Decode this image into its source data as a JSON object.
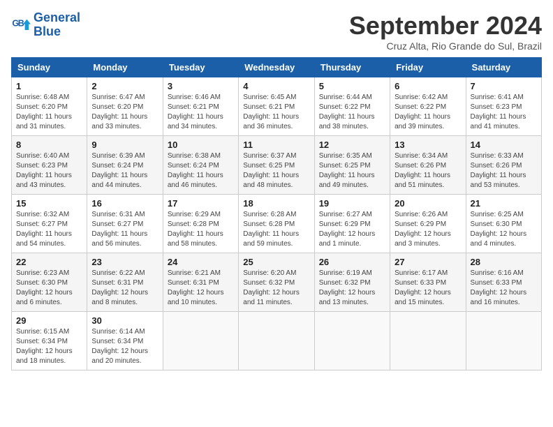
{
  "logo": {
    "line1": "General",
    "line2": "Blue"
  },
  "title": "September 2024",
  "location": "Cruz Alta, Rio Grande do Sul, Brazil",
  "weekdays": [
    "Sunday",
    "Monday",
    "Tuesday",
    "Wednesday",
    "Thursday",
    "Friday",
    "Saturday"
  ],
  "weeks": [
    [
      {
        "day": "1",
        "sunrise": "6:48 AM",
        "sunset": "6:20 PM",
        "daylight": "11 hours and 31 minutes."
      },
      {
        "day": "2",
        "sunrise": "6:47 AM",
        "sunset": "6:20 PM",
        "daylight": "11 hours and 33 minutes."
      },
      {
        "day": "3",
        "sunrise": "6:46 AM",
        "sunset": "6:21 PM",
        "daylight": "11 hours and 34 minutes."
      },
      {
        "day": "4",
        "sunrise": "6:45 AM",
        "sunset": "6:21 PM",
        "daylight": "11 hours and 36 minutes."
      },
      {
        "day": "5",
        "sunrise": "6:44 AM",
        "sunset": "6:22 PM",
        "daylight": "11 hours and 38 minutes."
      },
      {
        "day": "6",
        "sunrise": "6:42 AM",
        "sunset": "6:22 PM",
        "daylight": "11 hours and 39 minutes."
      },
      {
        "day": "7",
        "sunrise": "6:41 AM",
        "sunset": "6:23 PM",
        "daylight": "11 hours and 41 minutes."
      }
    ],
    [
      {
        "day": "8",
        "sunrise": "6:40 AM",
        "sunset": "6:23 PM",
        "daylight": "11 hours and 43 minutes."
      },
      {
        "day": "9",
        "sunrise": "6:39 AM",
        "sunset": "6:24 PM",
        "daylight": "11 hours and 44 minutes."
      },
      {
        "day": "10",
        "sunrise": "6:38 AM",
        "sunset": "6:24 PM",
        "daylight": "11 hours and 46 minutes."
      },
      {
        "day": "11",
        "sunrise": "6:37 AM",
        "sunset": "6:25 PM",
        "daylight": "11 hours and 48 minutes."
      },
      {
        "day": "12",
        "sunrise": "6:35 AM",
        "sunset": "6:25 PM",
        "daylight": "11 hours and 49 minutes."
      },
      {
        "day": "13",
        "sunrise": "6:34 AM",
        "sunset": "6:26 PM",
        "daylight": "11 hours and 51 minutes."
      },
      {
        "day": "14",
        "sunrise": "6:33 AM",
        "sunset": "6:26 PM",
        "daylight": "11 hours and 53 minutes."
      }
    ],
    [
      {
        "day": "15",
        "sunrise": "6:32 AM",
        "sunset": "6:27 PM",
        "daylight": "11 hours and 54 minutes."
      },
      {
        "day": "16",
        "sunrise": "6:31 AM",
        "sunset": "6:27 PM",
        "daylight": "11 hours and 56 minutes."
      },
      {
        "day": "17",
        "sunrise": "6:29 AM",
        "sunset": "6:28 PM",
        "daylight": "11 hours and 58 minutes."
      },
      {
        "day": "18",
        "sunrise": "6:28 AM",
        "sunset": "6:28 PM",
        "daylight": "11 hours and 59 minutes."
      },
      {
        "day": "19",
        "sunrise": "6:27 AM",
        "sunset": "6:29 PM",
        "daylight": "12 hours and 1 minute."
      },
      {
        "day": "20",
        "sunrise": "6:26 AM",
        "sunset": "6:29 PM",
        "daylight": "12 hours and 3 minutes."
      },
      {
        "day": "21",
        "sunrise": "6:25 AM",
        "sunset": "6:30 PM",
        "daylight": "12 hours and 4 minutes."
      }
    ],
    [
      {
        "day": "22",
        "sunrise": "6:23 AM",
        "sunset": "6:30 PM",
        "daylight": "12 hours and 6 minutes."
      },
      {
        "day": "23",
        "sunrise": "6:22 AM",
        "sunset": "6:31 PM",
        "daylight": "12 hours and 8 minutes."
      },
      {
        "day": "24",
        "sunrise": "6:21 AM",
        "sunset": "6:31 PM",
        "daylight": "12 hours and 10 minutes."
      },
      {
        "day": "25",
        "sunrise": "6:20 AM",
        "sunset": "6:32 PM",
        "daylight": "12 hours and 11 minutes."
      },
      {
        "day": "26",
        "sunrise": "6:19 AM",
        "sunset": "6:32 PM",
        "daylight": "12 hours and 13 minutes."
      },
      {
        "day": "27",
        "sunrise": "6:17 AM",
        "sunset": "6:33 PM",
        "daylight": "12 hours and 15 minutes."
      },
      {
        "day": "28",
        "sunrise": "6:16 AM",
        "sunset": "6:33 PM",
        "daylight": "12 hours and 16 minutes."
      }
    ],
    [
      {
        "day": "29",
        "sunrise": "6:15 AM",
        "sunset": "6:34 PM",
        "daylight": "12 hours and 18 minutes."
      },
      {
        "day": "30",
        "sunrise": "6:14 AM",
        "sunset": "6:34 PM",
        "daylight": "12 hours and 20 minutes."
      },
      null,
      null,
      null,
      null,
      null
    ]
  ],
  "labels": {
    "sunrise": "Sunrise:",
    "sunset": "Sunset:",
    "daylight": "Daylight:"
  }
}
